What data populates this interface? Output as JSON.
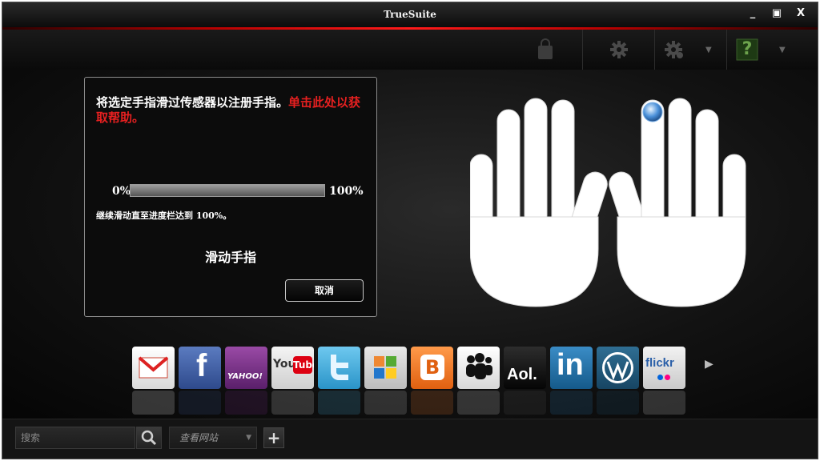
{
  "window": {
    "title": "TrueSuite",
    "minimize_glyph": "_",
    "maximize_glyph": "▣",
    "close_glyph": "X"
  },
  "toolbar": {
    "icons": [
      "shopping-bag-icon",
      "gear-icon",
      "gear-dropdown-icon",
      "help-icon"
    ],
    "help_label": "?"
  },
  "dialog": {
    "instruction": "将选定手指滑过传感器以注册手指。",
    "help_link": "单击此处以获取帮助。",
    "progress_min_label": "0%",
    "progress_max_label": "100%",
    "progress_value": 1.0,
    "hint": "继续滑动直至进度栏达到 100%。",
    "status": "滑动手指",
    "cancel_label": "取消"
  },
  "hands": {
    "selected_finger": "right-index"
  },
  "dock": {
    "items": [
      "Gmail",
      "Facebook",
      "Yahoo!",
      "YouTube",
      "Twitter",
      "Windows Live",
      "Blogger",
      "MySpace",
      "Aol.",
      "LinkedIn",
      "WordPress",
      "flickr"
    ],
    "labels": {
      "facebook": "f",
      "yahoo": "YAHOO!",
      "youtube_you": "You",
      "youtube_tube": "Tube",
      "aol": "Aol.",
      "linkedin": "in",
      "flickr": "flickr",
      "blogger": "B"
    }
  },
  "bottom": {
    "search_placeholder": "搜索",
    "site_select": "查看网站",
    "add_label": "+"
  },
  "colors": {
    "accent_red": "#e62020",
    "background": "#060606"
  }
}
